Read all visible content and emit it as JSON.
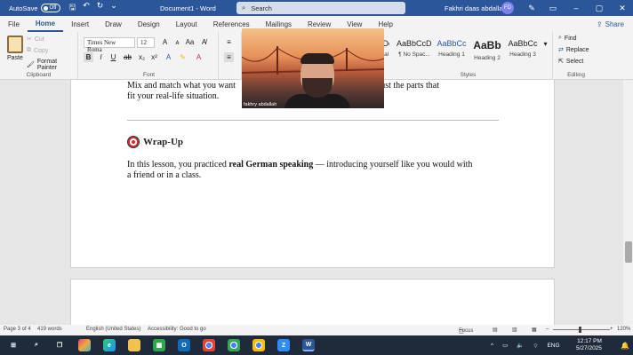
{
  "titlebar": {
    "autosave_label": "AutoSave",
    "autosave_state": "Off",
    "document_title": "Document1 - Word",
    "search_placeholder": "Search",
    "username": "Fakhri daas abdallah",
    "avatar_initials": "FD",
    "minimize": "–",
    "maximize": "▢",
    "close": "✕"
  },
  "tabs": [
    "File",
    "Home",
    "Insert",
    "Draw",
    "Design",
    "Layout",
    "References",
    "Mailings",
    "Review",
    "View",
    "Help"
  ],
  "active_tab": "Home",
  "share_label": "Share",
  "ribbon": {
    "clipboard": {
      "paste": "Paste",
      "cut": "Cut",
      "copy": "Copy",
      "format_painter": "Format Painter",
      "label": "Clipboard"
    },
    "font": {
      "name": "Times New Roma",
      "size": "12",
      "label": "Font"
    },
    "styles": {
      "items": [
        {
          "sample": "AaBbCcDc",
          "name": "¶ No Spac..."
        },
        {
          "sample": "AaBbCc",
          "name": "Heading 1"
        },
        {
          "sample": "AaBb",
          "name": "Heading 2"
        },
        {
          "sample": "AaBbCc",
          "name": "Heading 3"
        }
      ],
      "partial_sample": "cDc",
      "partial_name": "mal",
      "label": "Styles"
    },
    "editing": {
      "find": "Find",
      "replace": "Replace",
      "select": "Select",
      "label": "Editing"
    }
  },
  "document": {
    "para1_line1_a": "Mix and match what you want",
    "para1_line1_b": "sentence — just the parts that",
    "para1_line2": "fit your real-life situation.",
    "heading_emoji": "🎯",
    "heading": "Wrap-Up",
    "para2_pre": "In this lesson, you practiced ",
    "para2_bold": "real German speaking",
    "para2_post": " — introducing yourself like you would with",
    "para2_line2": "a friend or in a class."
  },
  "video": {
    "name": "fakhry abdallah"
  },
  "statusbar": {
    "page": "Page 3 of 4",
    "words": "419 words",
    "language": "English (United States)",
    "accessibility": "Accessibility: Good to go",
    "focus": "Focus",
    "zoom": "120%"
  },
  "taskbar": {
    "language": "ENG",
    "time": "12:17 PM",
    "date": "5/27/2025"
  },
  "colors": {
    "word_blue": "#2b579a",
    "taskbar": "#1f2a3a"
  }
}
